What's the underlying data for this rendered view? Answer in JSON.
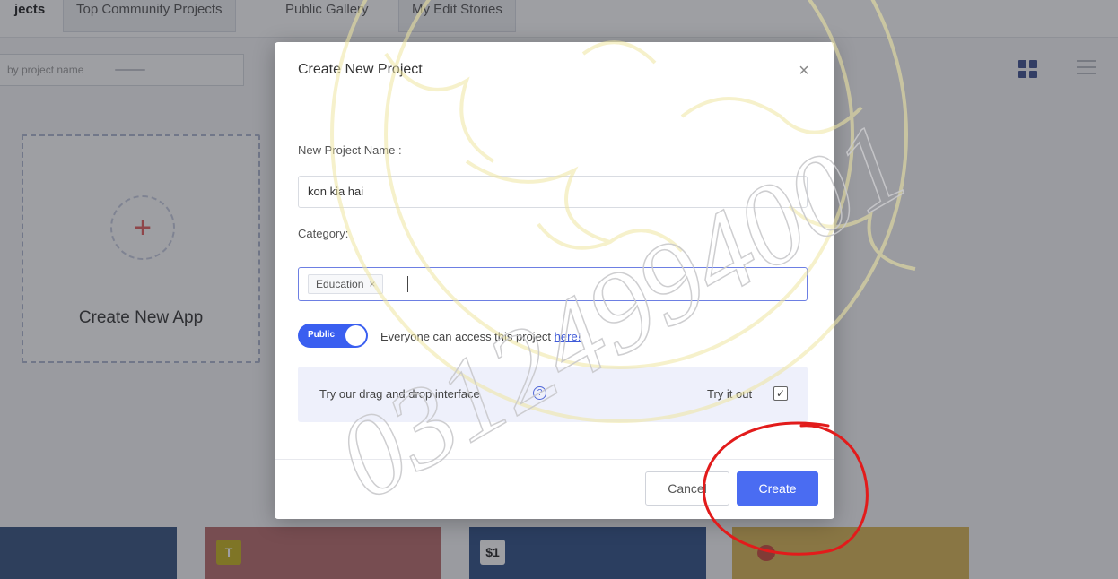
{
  "background": {
    "tabs": [
      "jects",
      "Top Community Projects",
      "Public Gallery",
      "My Edit Stories"
    ],
    "search_placeholder": "by project name",
    "create_card_title": "Create New App",
    "create_card_icon": "plus-icon",
    "app_cards": [
      {
        "color": "#33507f",
        "badge": ""
      },
      {
        "color": "#b96a6a",
        "badge": "T",
        "badge_color": "#c7b21d"
      },
      {
        "color": "#2f4f85",
        "badge": "$1",
        "badge_color": "#222"
      },
      {
        "color": "#d9b552",
        "badge": "",
        "badge_color": "#c94a3a"
      }
    ]
  },
  "modal": {
    "title": "Create New Project",
    "close_icon": "close-icon",
    "name_label": "New Project Name :",
    "name_value": "kon kia hai",
    "category_label": "Category:",
    "category_tag": "Education",
    "toggle_label": "Public",
    "toggle_on": true,
    "toggle_desc": "Everyone can access this project",
    "toggle_link": "here!",
    "dnd_text": "Try our drag and drop interface",
    "try_text": "Try it out",
    "try_checked": true,
    "cancel_label": "Cancel",
    "create_label": "Create"
  },
  "watermark": {
    "text": "03124994001"
  },
  "colors": {
    "accent": "#4a6cf2",
    "toggle": "#3a5ff0",
    "annotation_circle": "#e21b1b",
    "watermark": "#e8e2a8"
  }
}
